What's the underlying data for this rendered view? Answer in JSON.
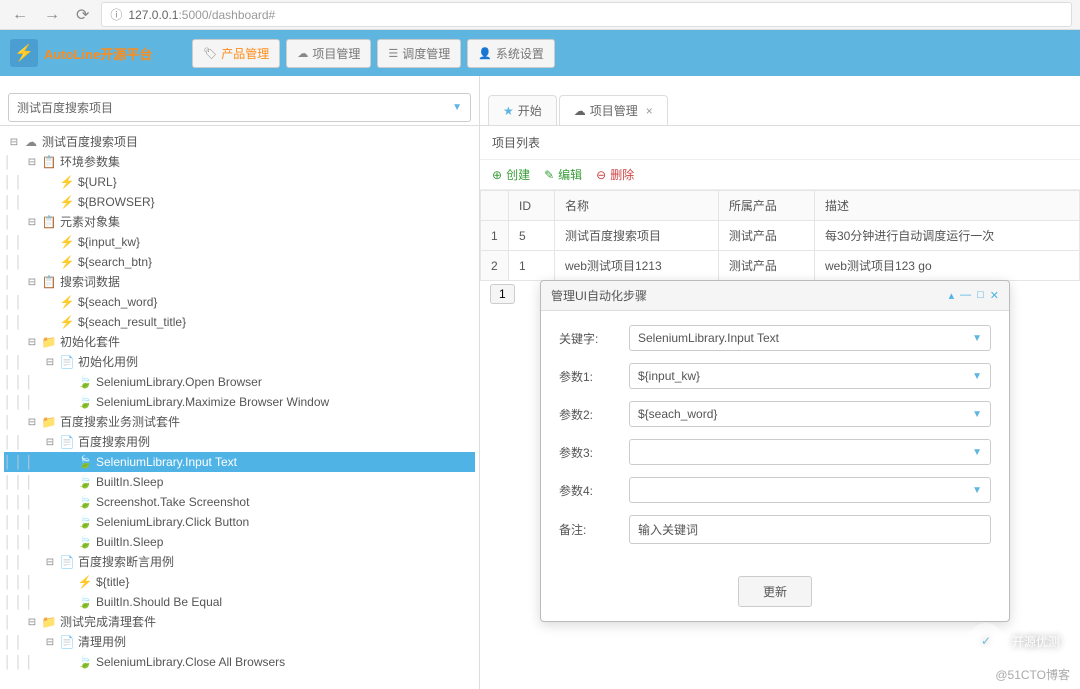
{
  "browser": {
    "url_prefix": "127.0.0.1",
    "url_suffix": ":5000/dashboard#"
  },
  "header": {
    "app_name": "AutoLine开源平台",
    "buttons": {
      "product": "产品管理",
      "project": "项目管理",
      "schedule": "调度管理",
      "settings": "系统设置"
    }
  },
  "left": {
    "combo_label": "测试百度搜索项目",
    "tree": [
      {
        "indent": 0,
        "toggle": "⊟",
        "icon": "☁",
        "label": "测试百度搜索项目"
      },
      {
        "indent": 1,
        "toggle": "⊟",
        "icon": "📋",
        "label": "环境参数集"
      },
      {
        "indent": 2,
        "toggle": "",
        "icon": "⚡",
        "label": "${URL}"
      },
      {
        "indent": 2,
        "toggle": "",
        "icon": "⚡",
        "label": "${BROWSER}"
      },
      {
        "indent": 1,
        "toggle": "⊟",
        "icon": "📋",
        "label": "元素对象集"
      },
      {
        "indent": 2,
        "toggle": "",
        "icon": "⚡",
        "label": "${input_kw}"
      },
      {
        "indent": 2,
        "toggle": "",
        "icon": "⚡",
        "label": "${search_btn}"
      },
      {
        "indent": 1,
        "toggle": "⊟",
        "icon": "📋",
        "label": "搜索词数据"
      },
      {
        "indent": 2,
        "toggle": "",
        "icon": "⚡",
        "label": "${seach_word}"
      },
      {
        "indent": 2,
        "toggle": "",
        "icon": "⚡",
        "label": "${seach_result_title}"
      },
      {
        "indent": 1,
        "toggle": "⊟",
        "icon": "📁",
        "label": "初始化套件"
      },
      {
        "indent": 2,
        "toggle": "⊟",
        "icon": "📄",
        "label": "初始化用例"
      },
      {
        "indent": 3,
        "toggle": "",
        "icon": "🍃",
        "label": "SeleniumLibrary.Open Browser"
      },
      {
        "indent": 3,
        "toggle": "",
        "icon": "🍃",
        "label": "SeleniumLibrary.Maximize Browser Window"
      },
      {
        "indent": 1,
        "toggle": "⊟",
        "icon": "📁",
        "label": "百度搜索业务测试套件"
      },
      {
        "indent": 2,
        "toggle": "⊟",
        "icon": "📄",
        "label": "百度搜索用例"
      },
      {
        "indent": 3,
        "toggle": "",
        "icon": "🍃",
        "label": "SeleniumLibrary.Input Text",
        "selected": true
      },
      {
        "indent": 3,
        "toggle": "",
        "icon": "🍃",
        "label": "BuiltIn.Sleep"
      },
      {
        "indent": 3,
        "toggle": "",
        "icon": "🍃",
        "label": "Screenshot.Take Screenshot"
      },
      {
        "indent": 3,
        "toggle": "",
        "icon": "🍃",
        "label": "SeleniumLibrary.Click Button"
      },
      {
        "indent": 3,
        "toggle": "",
        "icon": "🍃",
        "label": "BuiltIn.Sleep"
      },
      {
        "indent": 2,
        "toggle": "⊟",
        "icon": "📄",
        "label": "百度搜索断言用例"
      },
      {
        "indent": 3,
        "toggle": "",
        "icon": "⚡",
        "label": "${title}"
      },
      {
        "indent": 3,
        "toggle": "",
        "icon": "🍃",
        "label": "BuiltIn.Should Be Equal"
      },
      {
        "indent": 1,
        "toggle": "⊟",
        "icon": "📁",
        "label": "测试完成清理套件"
      },
      {
        "indent": 2,
        "toggle": "⊟",
        "icon": "📄",
        "label": "清理用例"
      },
      {
        "indent": 3,
        "toggle": "",
        "icon": "🍃",
        "label": "SeleniumLibrary.Close All Browsers"
      }
    ]
  },
  "right": {
    "tabs": {
      "start": "开始",
      "project": "项目管理"
    },
    "section_title": "项目列表",
    "actions": {
      "create": "创建",
      "edit": "编辑",
      "delete": "删除"
    },
    "columns": {
      "id": "ID",
      "name": "名称",
      "product": "所属产品",
      "desc": "描述"
    },
    "rows": [
      {
        "n": "1",
        "id": "5",
        "name": "测试百度搜索项目",
        "product": "测试产品",
        "desc": "每30分钟进行自动调度运行一次"
      },
      {
        "n": "2",
        "id": "1",
        "name": "web测试项目1213",
        "product": "测试产品",
        "desc": "web测试项目123 go"
      }
    ],
    "pager": "1"
  },
  "dialog": {
    "title": "管理UI自动化步骤",
    "fields": {
      "keyword_label": "关键字:",
      "keyword_value": "SeleniumLibrary.Input Text",
      "p1_label": "参数1:",
      "p1_value": "${input_kw}",
      "p2_label": "参数2:",
      "p2_value": "${seach_word}",
      "p3_label": "参数3:",
      "p3_value": "",
      "p4_label": "参数4:",
      "p4_value": "",
      "remark_label": "备注:",
      "remark_value": "输入关键词"
    },
    "update_btn": "更新"
  },
  "watermark": "开源优测",
  "attribution": "@51CTO博客"
}
